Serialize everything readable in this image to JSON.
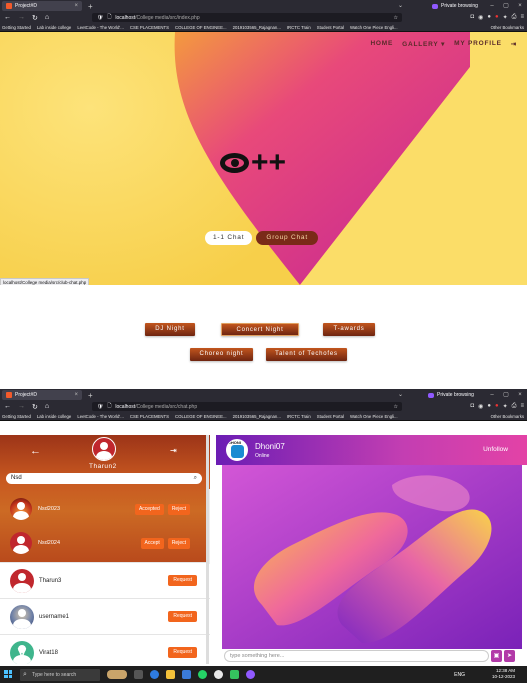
{
  "browser1": {
    "tab_title": "Project#D",
    "private_label": "Private browsing",
    "url_host": "localhost",
    "url_path": "/College media/src/index.php",
    "bookmarks": [
      "Getting Started",
      "Lab inside college",
      "LeetCode - The World'...",
      "CSE PLACEMENTS",
      "COLLEGE OF ENGINEE...",
      "2019103565_Rajagnan...",
      "IRCTC Train",
      "Student Portal",
      "Watch One Piece Engli..."
    ],
    "other_bookmarks": "Other Bookmarks"
  },
  "site": {
    "menu": [
      "HOME",
      "GALLERY",
      "MY PROFILE"
    ],
    "gallery_caret": "▾",
    "logo_text": "++",
    "chat_buttons": [
      "1-1 Chat",
      "Group Chat"
    ],
    "status_url": "localhost/College media/src/club-chat.php",
    "events": [
      "DJ Night",
      "Concert Night",
      "T-awards",
      "Choreo night",
      "Talent of Techofes"
    ]
  },
  "browser2": {
    "tab_title": "Project#D",
    "private_label": "Private browsing",
    "url_host": "localhost",
    "url_path": "/College media/src/chat.php",
    "bookmarks": [
      "Getting Started",
      "Lab inside college",
      "LeetCode - The World'...",
      "CSE PLACEMENTS",
      "COLLEGE OF ENGINEE...",
      "2019103565_Rajagnan...",
      "IRCTC Train",
      "Student Portal",
      "Watch One Piece Engli..."
    ],
    "other_bookmarks": "Other Bookmarks"
  },
  "chat": {
    "username": "Tharun2",
    "search_value": "Nsd",
    "requests": [
      {
        "name": "Nsd2023",
        "buttons": [
          "Accepted",
          "Reject"
        ]
      },
      {
        "name": "Nsd2024",
        "buttons": [
          "Accept",
          "Reject"
        ]
      }
    ],
    "suggestions": [
      {
        "name": "Tharun3",
        "button": "Request"
      },
      {
        "name": "username1",
        "button": "Request"
      },
      {
        "name": "Virat18",
        "button": "Request"
      }
    ],
    "contact_name": "Dhoni07",
    "contact_status": "Online",
    "contact_avatar_text": "DHONI",
    "unfollow": "Unfollow",
    "input_placeholder": "type something here..."
  },
  "taskbar": {
    "search_placeholder": "Type here to search",
    "lang": "ENG",
    "time": "12:38 AM",
    "date": "10-12-2023"
  },
  "colors": {
    "accent": "#f2651d",
    "hero_yellow": "#fbdd68",
    "hero_magenta": "#d9347d",
    "chat_purple": "#7a22b8"
  }
}
